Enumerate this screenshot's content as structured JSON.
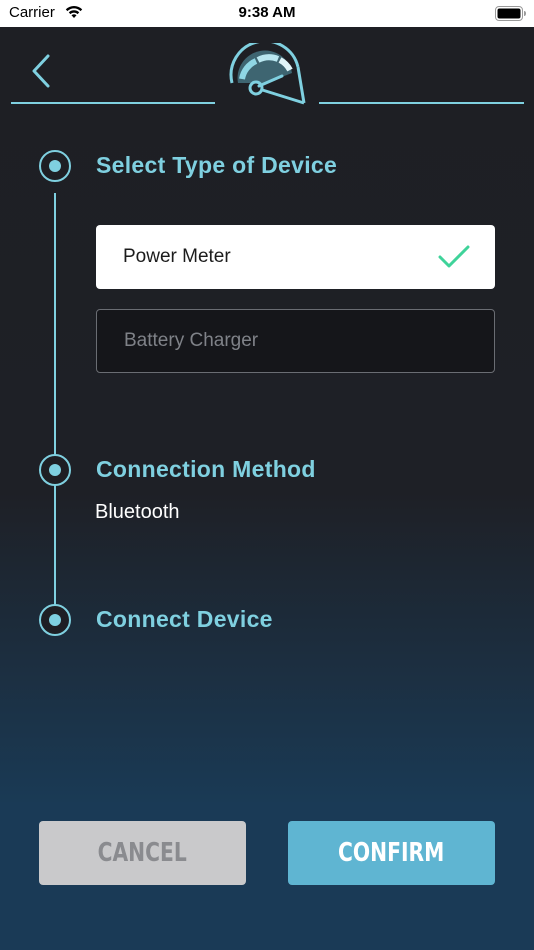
{
  "status_bar": {
    "carrier": "Carrier",
    "time": "9:38 AM"
  },
  "header": {
    "back_icon": "chevron-left-icon",
    "logo_icon": "speedometer-gauge-icon"
  },
  "steps": [
    {
      "title": "Select Type of Device",
      "options": [
        {
          "label": "Power Meter",
          "selected": true
        },
        {
          "label": "Battery Charger",
          "selected": false
        }
      ]
    },
    {
      "title": "Connection Method",
      "value": "Bluetooth"
    },
    {
      "title": "Connect Device"
    }
  ],
  "footer": {
    "cancel_label": "CANCEL",
    "confirm_label": "CONFIRM"
  },
  "colors": {
    "accent": "#7fd0e0",
    "check": "#3fd39a",
    "confirm_button": "#5fb5d2",
    "cancel_button": "#c9c9cb",
    "background": "#1e1f24",
    "footer": "#1a3a56"
  }
}
